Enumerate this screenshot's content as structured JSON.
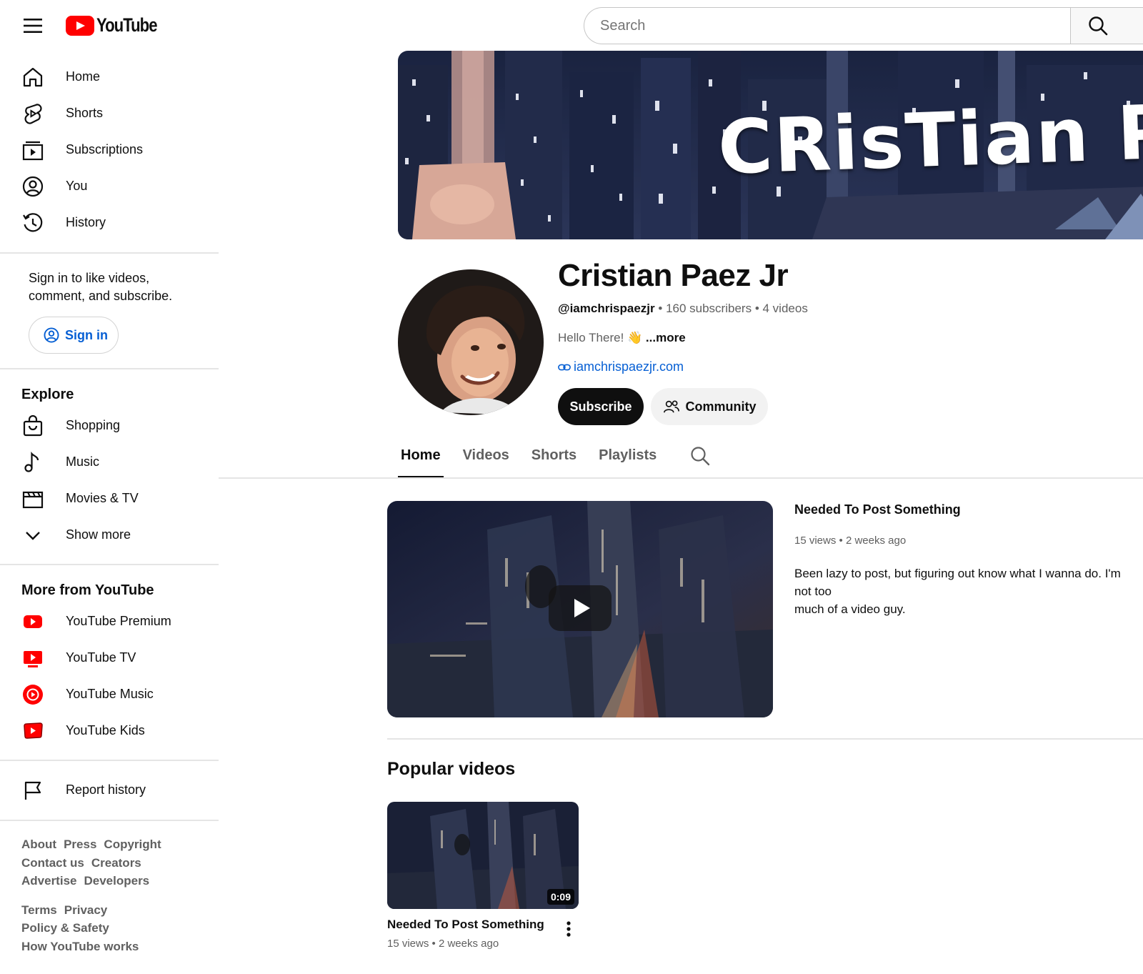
{
  "app": {
    "logo_text": "YouTube"
  },
  "search": {
    "placeholder": "Search"
  },
  "sidebar": {
    "main": [
      {
        "label": "Home",
        "icon": "home-icon"
      },
      {
        "label": "Shorts",
        "icon": "shorts-icon"
      },
      {
        "label": "Subscriptions",
        "icon": "subscriptions-icon"
      },
      {
        "label": "You",
        "icon": "account-icon"
      },
      {
        "label": "History",
        "icon": "history-icon"
      }
    ],
    "signin_prompt": "Sign in to like videos, comment, and subscribe.",
    "signin_label": "Sign in",
    "explore_title": "Explore",
    "explore": [
      {
        "label": "Shopping",
        "icon": "shopping-bag-icon"
      },
      {
        "label": "Music",
        "icon": "music-note-icon"
      },
      {
        "label": "Movies & TV",
        "icon": "clapperboard-icon"
      },
      {
        "label": "Show more",
        "icon": "chevron-down-icon"
      }
    ],
    "more_title": "More from YouTube",
    "more": [
      {
        "label": "YouTube Premium",
        "icon": "youtube-premium-icon"
      },
      {
        "label": "YouTube TV",
        "icon": "youtube-tv-icon"
      },
      {
        "label": "YouTube Music",
        "icon": "youtube-music-icon"
      },
      {
        "label": "YouTube Kids",
        "icon": "youtube-kids-icon"
      }
    ],
    "report_history": "Report history",
    "footer_rows_1": [
      [
        "About",
        "Press",
        "Copyright"
      ],
      [
        "Contact us",
        "Creators"
      ],
      [
        "Advertise",
        "Developers"
      ]
    ],
    "footer_rows_2": [
      [
        "Terms",
        "Privacy"
      ],
      [
        "Policy & Safety"
      ],
      [
        "How YouTube works"
      ]
    ]
  },
  "channel": {
    "banner_text": "CRisTian Paez",
    "name": "Cristian Paez Jr",
    "handle": "@iamchrispaezjr",
    "subscribers": "160 subscribers",
    "videos_count": "4 videos",
    "description": "Hello There! 👋",
    "more_label": "...more",
    "link": "iamchrispaezjr.com",
    "subscribe_label": "Subscribe",
    "community_label": "Community"
  },
  "tabs": [
    "Home",
    "Videos",
    "Shorts",
    "Playlists"
  ],
  "featured": {
    "title": "Needed To Post Something",
    "views": "15 views",
    "age": "2 weeks ago",
    "description": "Been lazy to post, but figuring out know what I wanna do. I'm not too\nmuch of a video guy."
  },
  "popular": {
    "heading": "Popular videos",
    "videos": [
      {
        "title": "Needed To Post Something",
        "views": "15 views",
        "age": "2 weeks ago",
        "duration": "0:09"
      }
    ]
  },
  "colors": {
    "brand_red": "#ff0000",
    "link_blue": "#065fd4",
    "text_primary": "#0f0f0f",
    "text_secondary": "#606060"
  }
}
